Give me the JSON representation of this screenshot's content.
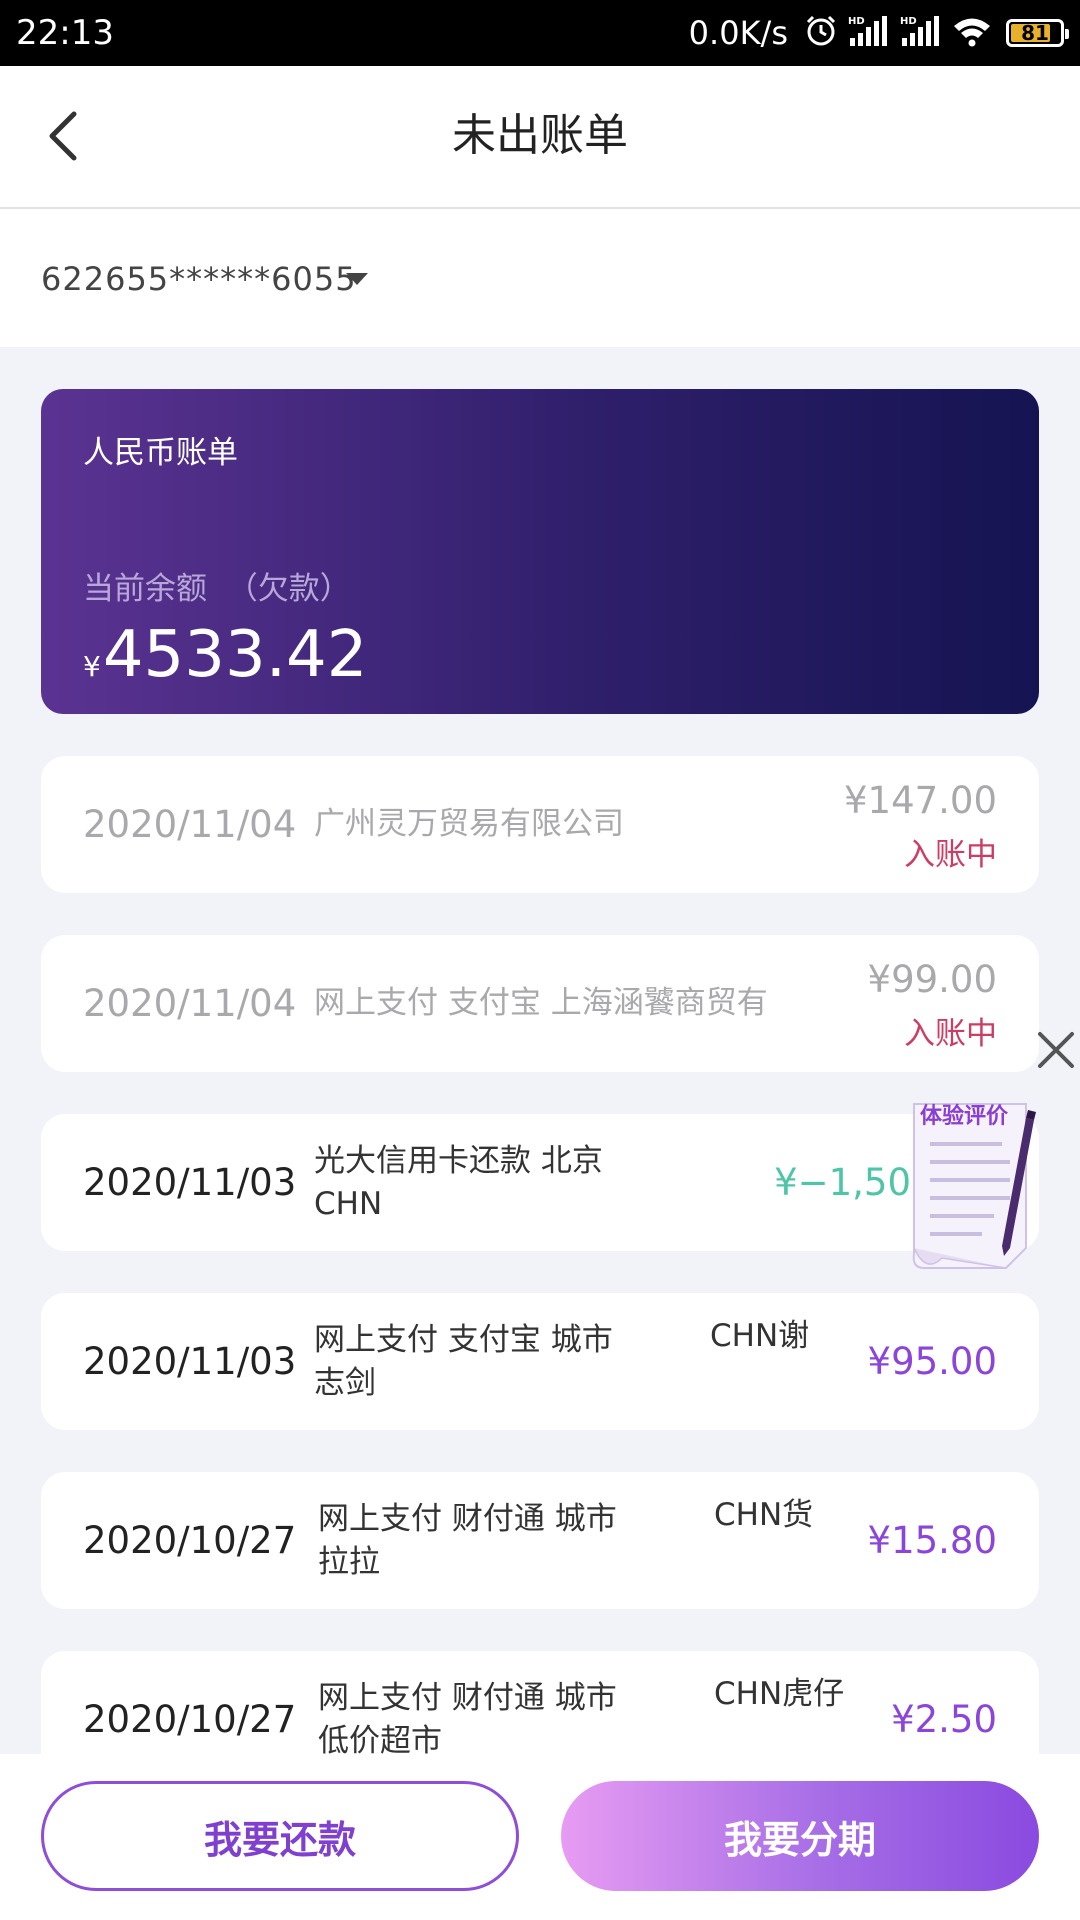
{
  "status_bar": {
    "time": "22:13",
    "net_speed": "0.0K/s",
    "battery": "81",
    "battery_level": 0.81,
    "icons": [
      "alarm-icon",
      "hd-signal-icon",
      "hd-signal-icon",
      "wifi-icon",
      "battery-icon"
    ]
  },
  "header": {
    "title": "未出账单",
    "back_icon": "chevron-left-icon"
  },
  "card_selector": {
    "number": "622655******6055",
    "icon": "caret-down-icon"
  },
  "balance_card": {
    "title": "人民币账单",
    "label": "当前余额  （欠款）",
    "currency": "¥",
    "amount": "4533.42"
  },
  "transactions": [
    {
      "date": "2020/11/04",
      "desc": "广州灵万贸易有限公司",
      "extra": "",
      "amount": "¥147.00",
      "status": "入账中"
    },
    {
      "date": "2020/11/04",
      "desc": "网上支付 支付宝 上海涵饕商贸有",
      "extra": "",
      "amount": "¥99.00",
      "status": "入账中"
    },
    {
      "date": "2020/11/03",
      "desc": "光大信用卡还款 北京 CHN",
      "extra": "",
      "amount": "¥−1,50",
      "status": ""
    },
    {
      "date": "2020/11/03",
      "desc": "网上支付 支付宝 城市 志剑",
      "extra": "CHN谢",
      "amount": "¥95.00",
      "status": ""
    },
    {
      "date": "2020/10/27",
      "desc": "网上支付 财付通 城市 拉拉",
      "extra": "CHN货",
      "amount": "¥15.80",
      "status": ""
    },
    {
      "date": "2020/10/27",
      "desc": "网上支付 财付通 城市 低价超市",
      "extra": "CHN虎仔",
      "amount": "¥2.50",
      "status": ""
    }
  ],
  "floating": {
    "close_icon": "close-icon",
    "survey_label": "体验评价"
  },
  "bottom_bar": {
    "repay_label": "我要还款",
    "installment_label": "我要分期"
  },
  "colors": {
    "accent": "#8b45d9",
    "pending_status": "#cd3d63",
    "refund": "#4fc5a8",
    "card_gradient_start": "#5b3392",
    "card_gradient_end": "#151451"
  }
}
